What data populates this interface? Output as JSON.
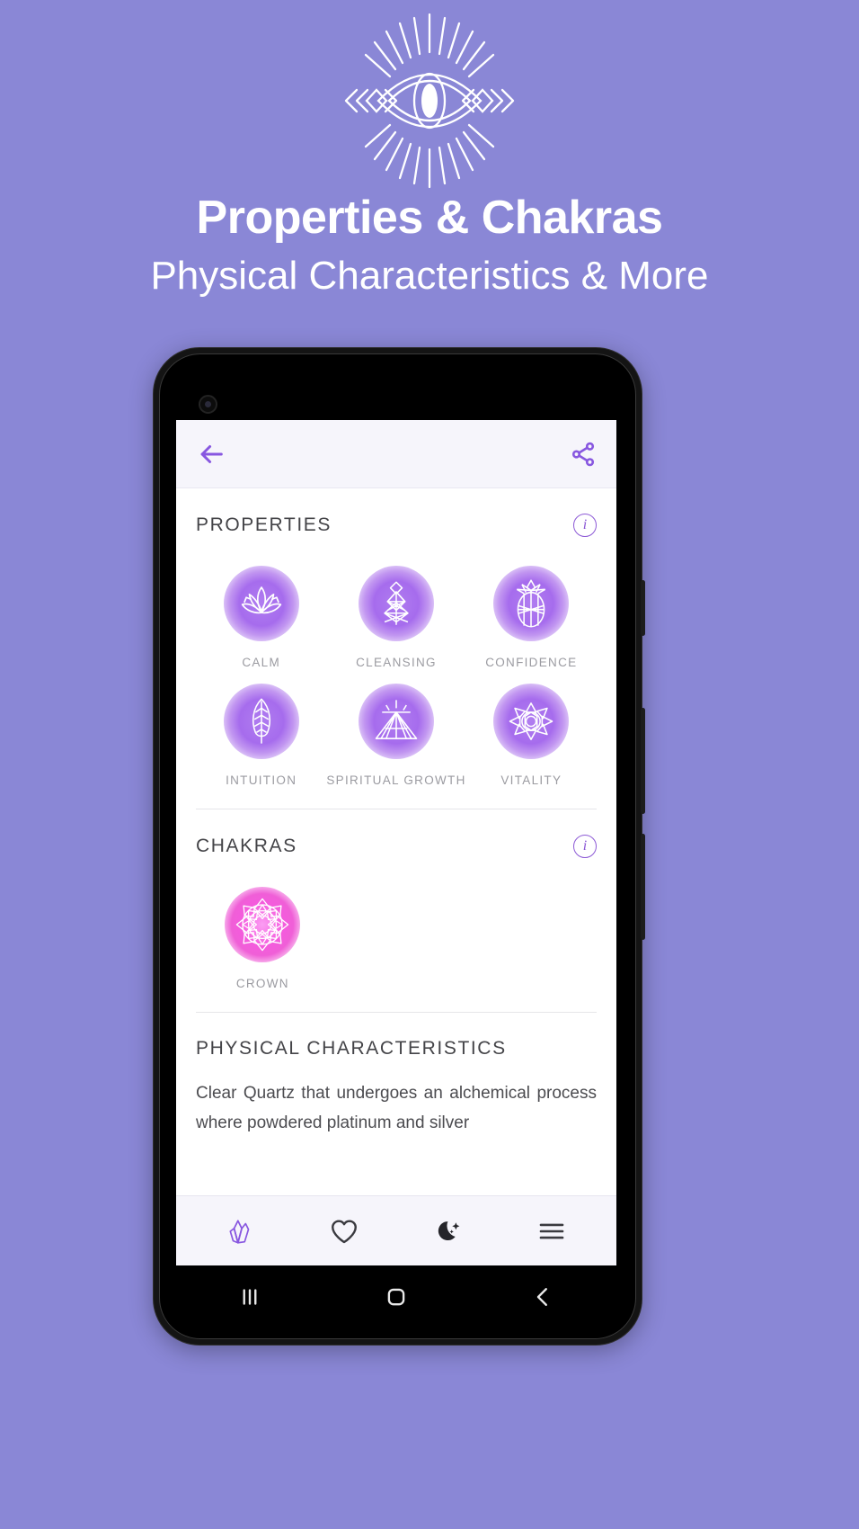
{
  "hero": {
    "logo_icon": "all-seeing-eye-icon",
    "title": "Properties & Chakras",
    "subtitle": "Physical Characteristics & More"
  },
  "colors": {
    "background": "#8a87d6",
    "accent_purple": "#8d5ad6",
    "orb_purple": "#a66ced",
    "orb_pink": "#ec37cd",
    "appbar_bg": "#f6f5fb",
    "label_gray": "#9b9ba1",
    "title_gray": "#444448"
  },
  "app": {
    "appbar": {
      "back_icon": "arrow-left-icon",
      "share_icon": "share-icon"
    },
    "sections": [
      {
        "title": "PROPERTIES",
        "info_label": "i",
        "items": [
          {
            "label": "CALM",
            "icon": "lotus-icon",
            "orb": "purple"
          },
          {
            "label": "CLEANSING",
            "icon": "pine-tree-icon",
            "orb": "purple"
          },
          {
            "label": "CONFIDENCE",
            "icon": "pineapple-icon",
            "orb": "purple"
          },
          {
            "label": "INTUITION",
            "icon": "feather-icon",
            "orb": "purple"
          },
          {
            "label": "SPIRITUAL GROWTH",
            "icon": "sunburst-icon",
            "orb": "purple"
          },
          {
            "label": "VITALITY",
            "icon": "flower-icon",
            "orb": "purple"
          }
        ]
      },
      {
        "title": "CHAKRAS",
        "info_label": "i",
        "items": [
          {
            "label": "CROWN",
            "icon": "crown-chakra-icon",
            "orb": "pink"
          }
        ]
      }
    ],
    "physical": {
      "title": "PHYSICAL CHARACTERISTICS",
      "body": "Clear Quartz that undergoes an alchemical process where powdered platinum and silver"
    },
    "bottom_nav": [
      {
        "name": "crystals-tab",
        "icon": "crystal-icon",
        "active": true
      },
      {
        "name": "favorites-tab",
        "icon": "heart-icon",
        "active": false
      },
      {
        "name": "moon-tab",
        "icon": "moon-stars-icon",
        "active": false
      },
      {
        "name": "menu-tab",
        "icon": "hamburger-icon",
        "active": false
      }
    ]
  },
  "system_nav": {
    "recents_icon": "recents-icon",
    "home_icon": "home-circle-icon",
    "back_icon": "back-chevron-icon"
  }
}
